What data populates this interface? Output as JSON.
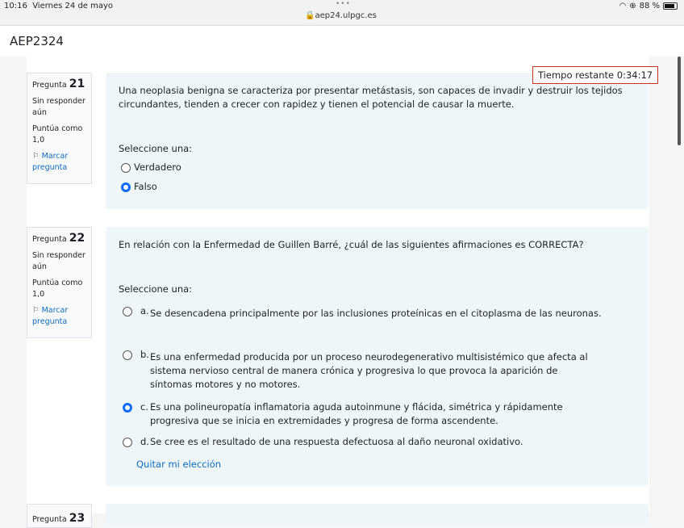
{
  "status_bar": {
    "time": "10:16",
    "date": "Viernes 24 de mayo",
    "dots": "•••",
    "url": "aep24.ulpgc.es",
    "battery": "88 %",
    "wifi_icon": "wifi-icon"
  },
  "header": {
    "title": "AEP2324"
  },
  "timer": {
    "text": "Tiempo restante 0:34:17"
  },
  "questions": [
    {
      "label": "Pregunta",
      "number": "21",
      "status": "Sin responder aún",
      "score": "Puntúa como 1,0",
      "flag": "Marcar pregunta",
      "text": "Una neoplasia benigna se caracteriza por presentar metástasis, son capaces de invadir y destruir los tejidos circundantes, tienden a crecer con rapidez y tienen el potencial de causar la muerte.",
      "prompt": "Seleccione una:",
      "options": [
        {
          "text": "Verdadero",
          "selected": false
        },
        {
          "text": "Falso",
          "selected": true
        }
      ]
    },
    {
      "label": "Pregunta",
      "number": "22",
      "status": "Sin responder aún",
      "score": "Puntúa como 1,0",
      "flag": "Marcar pregunta",
      "text": "En relación con la Enfermedad de Guillen Barré, ¿cuál de las siguientes afirmaciones es CORRECTA?",
      "prompt": "Seleccione una:",
      "options": [
        {
          "letter": "a.",
          "text": "Se desencadena principalmente por las inclusiones proteínicas en el citoplasma de las neuronas.",
          "selected": false
        },
        {
          "letter": "b.",
          "text": "Es una enfermedad producida por un proceso neurodegenerativo multisistémico que afecta al sistema nervioso central de manera crónica y progresiva lo que provoca la aparición de síntomas motores y no motores.",
          "selected": false
        },
        {
          "letter": "c.",
          "text": "Es una polineuropatía inflamatoria aguda autoinmune y flácida, simétrica y rápidamente progresiva que se inicia en extremidades y progresa de forma ascendente.",
          "selected": true
        },
        {
          "letter": "d.",
          "text": "Se cree es el resultado de una respuesta defectuosa al daño neuronal oxidativo.",
          "selected": false
        }
      ],
      "clear": "Quitar mi elección"
    },
    {
      "label": "Pregunta",
      "number": "23"
    }
  ]
}
